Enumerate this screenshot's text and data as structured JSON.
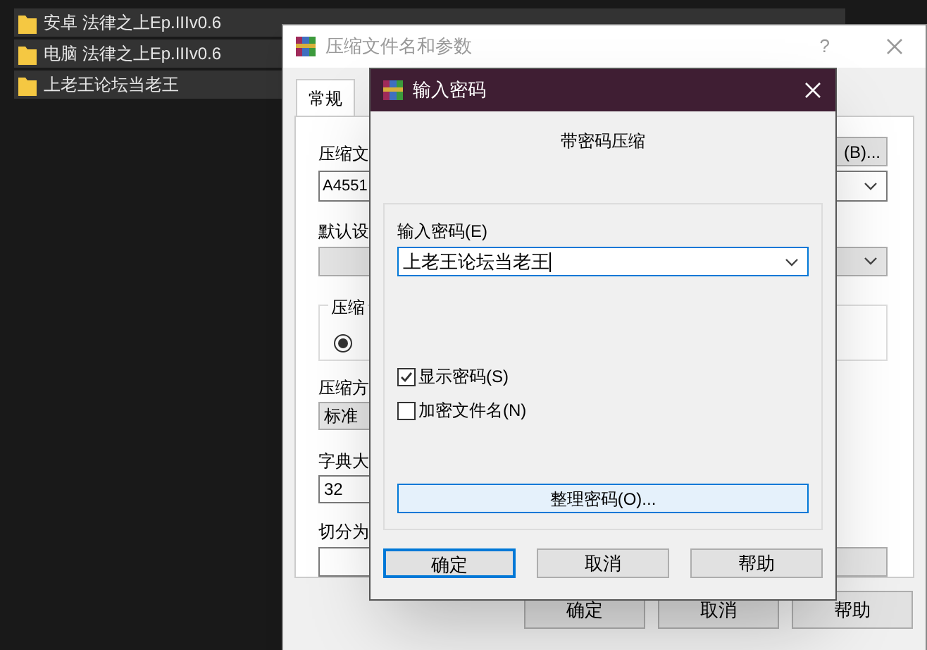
{
  "file_list": {
    "rows": [
      {
        "name": "安卓 法律之上Ep.IIIv0.6"
      },
      {
        "name": "电脑 法律之上Ep.IIIv0.6"
      },
      {
        "name": "上老王论坛当老王"
      }
    ]
  },
  "archive_dialog": {
    "title": "压缩文件名和参数",
    "help": "?",
    "tabs": [
      {
        "label": "常规",
        "selected": true
      }
    ],
    "archive_name_label": "压缩文",
    "archive_name_value": "A4551",
    "browse_button": "(B)...",
    "profile_label": "默认设",
    "format_group_label": "压缩",
    "format_radio_selected": true,
    "method_label": "压缩方",
    "method_value": "标准",
    "dictionary_label": "字典大",
    "dictionary_value": "32",
    "split_label": "切分为",
    "buttons": [
      "确定",
      "取消",
      "帮助"
    ]
  },
  "password_dialog": {
    "title": "输入密码",
    "heading": "带密码压缩",
    "password_label": "输入密码(E)",
    "password_value": "上老王论坛当老王",
    "checkboxes": [
      {
        "label": "显示密码(S)",
        "checked": true
      },
      {
        "label": "加密文件名(N)",
        "checked": false
      }
    ],
    "organize_button": "整理密码(O)...",
    "buttons": [
      {
        "label": "确定",
        "default": true
      },
      {
        "label": "取消",
        "default": false
      },
      {
        "label": "帮助",
        "default": false
      }
    ]
  }
}
